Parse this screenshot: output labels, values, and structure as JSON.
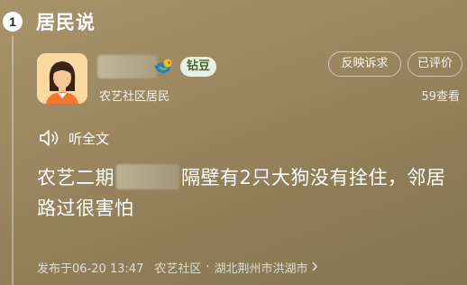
{
  "section": {
    "step_number": "1",
    "title": "居民说"
  },
  "author": {
    "level_badge": "钻豆",
    "role": "农艺社区居民"
  },
  "actions": {
    "report_label": "反映诉求",
    "rated_label": "已评价"
  },
  "stats": {
    "views": "59查看"
  },
  "listen": {
    "label": "听全文"
  },
  "post": {
    "text_part1": "农艺二期",
    "text_part2": "隔壁有2只大狗没有拴住，邻居路过很害怕"
  },
  "meta": {
    "published": "发布于06-20 13:47",
    "community": "农艺社区",
    "separator": "·",
    "location": "湖北荆州市洪湖市"
  },
  "colors": {
    "background": "#9a8660",
    "badge_bg": "#e9efe2",
    "badge_text": "#3e6a2e",
    "avatar_bg": "#fdd9a2"
  }
}
